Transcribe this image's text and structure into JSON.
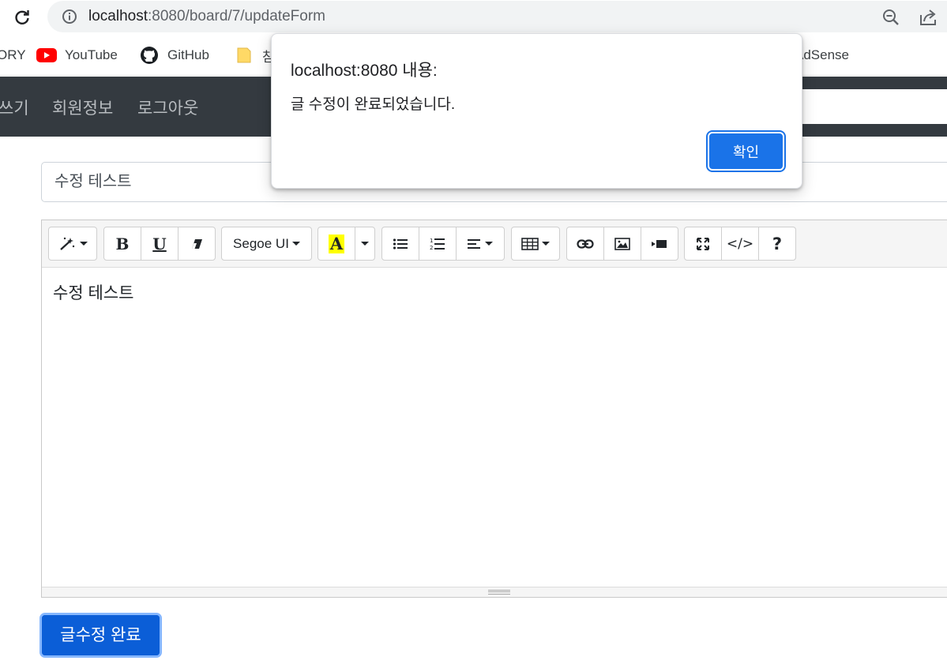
{
  "browser": {
    "url_host": "localhost",
    "url_path": ":8080/board/7/updateForm",
    "bookmarks": [
      {
        "label": "ORY",
        "icon": "bookmark-partial"
      },
      {
        "label": "YouTube",
        "icon": "youtube-icon"
      },
      {
        "label": "GitHub",
        "icon": "github-icon"
      },
      {
        "label": "참",
        "icon": "folder-icon"
      },
      {
        "label": "AdSense",
        "icon": "adsense"
      }
    ]
  },
  "navbar": {
    "links": [
      "쓰기",
      "회원정보",
      "로그아웃"
    ]
  },
  "form": {
    "title_value": "수정 테스트",
    "content_value": "수정 테스트",
    "submit_label": "글수정 완료"
  },
  "editor": {
    "font_name": "Segoe UI",
    "toolbar_icons": [
      "magic-icon",
      "bold-icon",
      "underline-icon",
      "eraser-icon",
      "font-name-dropdown",
      "highlight-color-icon",
      "color-caret-icon",
      "unordered-list-icon",
      "ordered-list-icon",
      "align-icon",
      "table-icon",
      "link-icon",
      "picture-icon",
      "video-icon",
      "fullscreen-icon",
      "code-view-icon",
      "help-icon"
    ],
    "bold_label": "B",
    "underline_label": "U",
    "color_label": "A",
    "help_label": "?",
    "code_label": "</>"
  },
  "dialog": {
    "title": "localhost:8080 내용:",
    "message": "글 수정이 완료되었습니다.",
    "ok_label": "확인"
  },
  "colors": {
    "navbar": "#343a40",
    "primary": "#0d6efd",
    "dialog_button": "#1a73e8",
    "highlight": "#ffff00"
  }
}
